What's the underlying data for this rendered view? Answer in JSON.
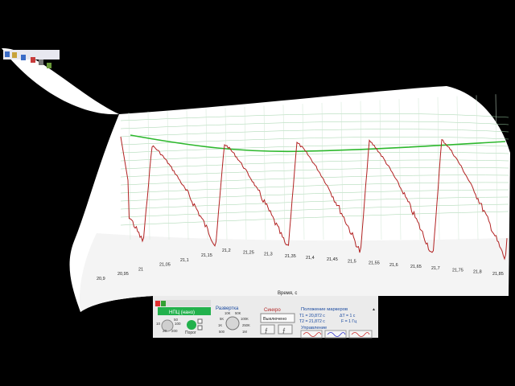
{
  "plot": {
    "x_axis_title": "Время, с",
    "x_ticks": [
      "20,9",
      "20,95",
      "21",
      "21,05",
      "21,1",
      "21,15",
      "21,2",
      "21,25",
      "21,3",
      "21,35",
      "21,4",
      "21,45",
      "21,5",
      "21,55",
      "21,6",
      "21,65",
      "21,7",
      "21,75",
      "21,8",
      "21,85"
    ],
    "signal_color": "#b22222",
    "trigger_color": "#2db82d",
    "grid_color": "#9fd3a8"
  },
  "controls": {
    "channel_label": "НПЦ (нано)",
    "threshold_label": "Порог",
    "knob_ticks_left": [
      "10",
      "20",
      "100",
      "200",
      "50"
    ],
    "sweep_title": "Развертка",
    "sweep_ticks": [
      "10K",
      "50K",
      "5K",
      "100K",
      "1K",
      "250K",
      "500",
      "1M"
    ],
    "sync_title": "Синхро",
    "sync_value": "Выключено",
    "markers_title": "Положение маркеров",
    "t1_text": "T1 = 20,872 с",
    "t2_text": "T2 = 21,872 с",
    "dt_text": "ΔT = 1 с",
    "f_text": "F = 1 Гц",
    "manage_title": "Управление"
  }
}
